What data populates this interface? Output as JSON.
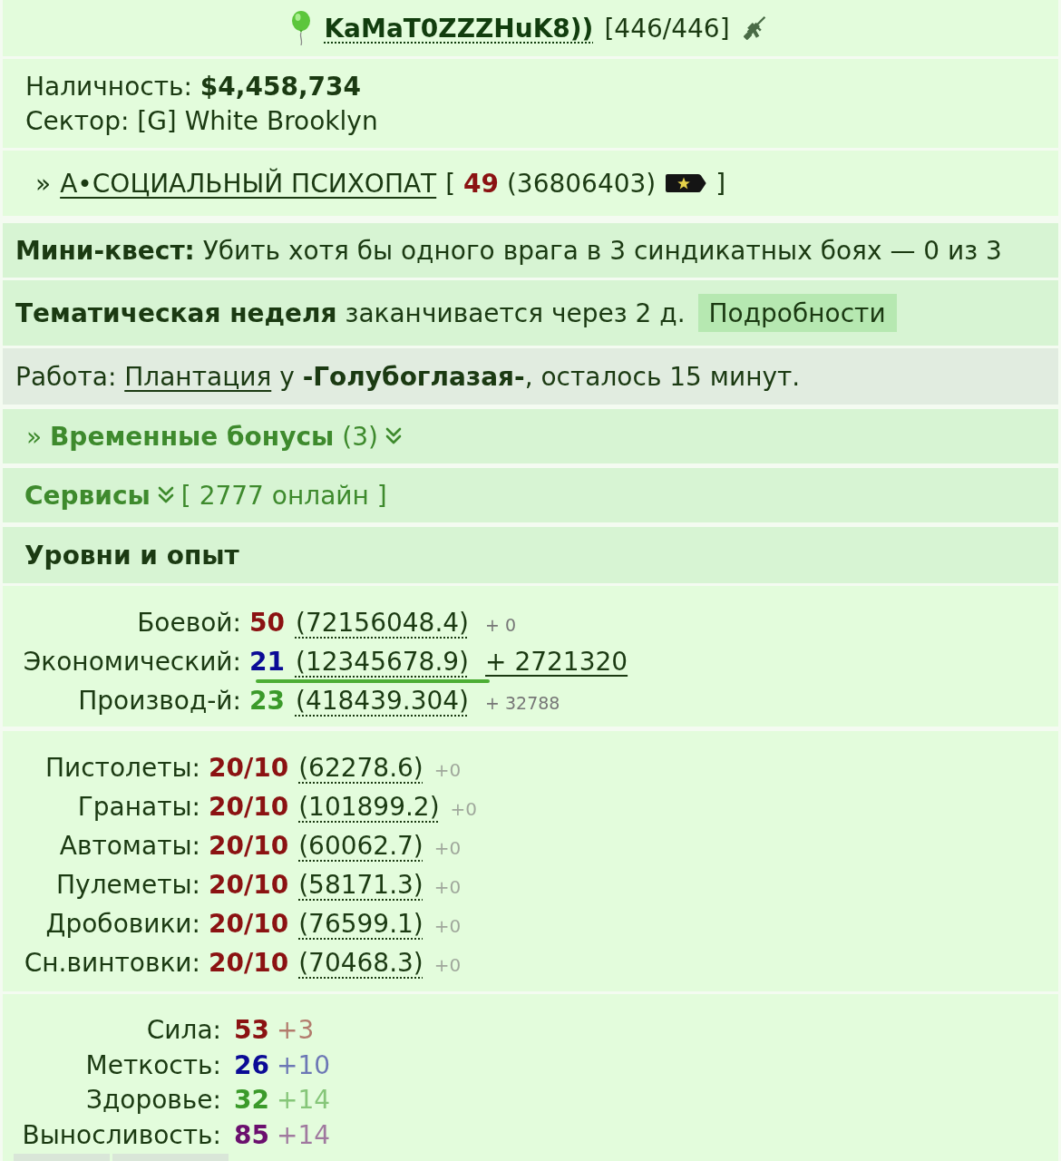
{
  "header": {
    "name": "KaMaT0ZZZHuK8))",
    "health": "[446/446]"
  },
  "account": {
    "cash": "Наличность: **$4,458,734**",
    "sector": "Сектор: [G] White Brooklyn"
  },
  "rank": {
    "prefix": "»",
    "title": "А•СОЦИАЛЬНЫЙ ПСИХОПАТ",
    "details": "[ **49** (36806403)",
    "closing": "]"
  },
  "mini_quest": {
    "text": "**Мини-квест:** Убить хотя бы одного врага в 3 синдикатных боях — 0 из 3"
  },
  "theme_week": {
    "text": "**Тематическая неделя** заканчивается через 2 д.",
    "button": "Подробности"
  },
  "work": {
    "label": "Работа:",
    "link": "Плантация",
    "rest": "у **-Голубоглазая-**, осталось 15 минут."
  },
  "bonuses": {
    "text": "» **Временные бонусы** (3)",
    "expanded": false
  },
  "services": {
    "label": "Сервисы",
    "expanded": false,
    "online": "[ 2777 онлайн ]"
  },
  "levels": {
    "title": "Уровни и опыт",
    "rows": [
      {
        "label": "Боевой:",
        "value": "50",
        "color": "#8b1212",
        "experience": "(72156048.4)",
        "gain": "+ 0",
        "highlighted": false
      },
      {
        "label": "Экономический:",
        "value": "21",
        "color": "#0b0b96",
        "experience": "(12345678.9)",
        "gain": "+ 2721320",
        "highlighted": true
      },
      {
        "label": "Производ-й:",
        "value": "23",
        "color": "#3b9a2a",
        "experience": "(418439.304)",
        "gain": "+ 32788",
        "highlighted": false
      }
    ]
  },
  "weapons": [
    {
      "label": "Пистолеты:",
      "value": "20/10",
      "experience": "(62278.6)",
      "gain": "+0"
    },
    {
      "label": "Гранаты:",
      "value": "20/10",
      "experience": "(101899.2)",
      "gain": "+0"
    },
    {
      "label": "Автоматы:",
      "value": "20/10",
      "experience": "(60062.7)",
      "gain": "+0"
    },
    {
      "label": "Пулеметы:",
      "value": "20/10",
      "experience": "(58171.3)",
      "gain": "+0"
    },
    {
      "label": "Дробовики:",
      "value": "20/10",
      "experience": "(76599.1)",
      "gain": "+0"
    },
    {
      "label": "Сн.винтовки:",
      "value": "20/10",
      "experience": "(70468.3)",
      "gain": "+0"
    }
  ],
  "stats": [
    {
      "label": "Сила:",
      "value": "53",
      "bonus": "+3",
      "color": "#8b1212"
    },
    {
      "label": "Меткость:",
      "value": "26",
      "bonus": "+10",
      "color": "#0b0b96"
    },
    {
      "label": "Здоровье:",
      "value": "32",
      "bonus": "+14",
      "color": "#3b9a2a"
    },
    {
      "label": "Выносливость:",
      "value": "85",
      "bonus": "+14",
      "color": "#6b0f6e"
    }
  ]
}
